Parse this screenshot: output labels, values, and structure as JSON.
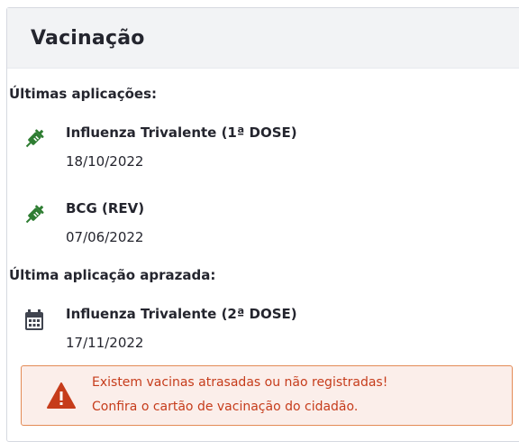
{
  "card": {
    "title": "Vacinação",
    "recent_label": "Últimas aplicações:",
    "recent": [
      {
        "icon": "syringe-icon",
        "name": "Influenza Trivalente (1ª DOSE)",
        "date": "18/10/2022"
      },
      {
        "icon": "syringe-icon",
        "name": "BCG (REV)",
        "date": "07/06/2022"
      }
    ],
    "scheduled_label": "Última aplicação aprazada:",
    "scheduled": {
      "icon": "calendar-icon",
      "name": "Influenza Trivalente (2ª DOSE)",
      "date": "17/11/2022"
    },
    "alert": {
      "icon": "warning-icon",
      "line1": "Existem vacinas atrasadas ou não registradas!",
      "line2": "Confira o cartão de vacinação do cidadão."
    }
  },
  "colors": {
    "syringe": "#2e7d32",
    "alert_text": "#c63c1b",
    "alert_border": "#e38b56",
    "alert_bg": "#fbeeea"
  }
}
